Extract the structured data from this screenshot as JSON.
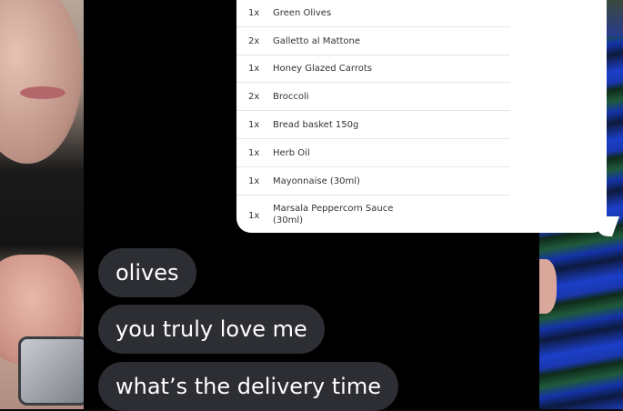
{
  "order_items": [
    {
      "qty": "1x",
      "name": "Green Olives"
    },
    {
      "qty": "2x",
      "name": "Galletto al Mattone"
    },
    {
      "qty": "1x",
      "name": "Honey Glazed Carrots"
    },
    {
      "qty": "2x",
      "name": "Broccoli"
    },
    {
      "qty": "1x",
      "name": "Bread basket 150g"
    },
    {
      "qty": "1x",
      "name": "Herb Oil"
    },
    {
      "qty": "1x",
      "name": "Mayonnaise (30ml)"
    },
    {
      "qty": "1x",
      "name": "Marsala Peppercorn Sauce (30ml)"
    }
  ],
  "messages": [
    {
      "text": "olives"
    },
    {
      "text": "you truly love me"
    },
    {
      "text": "what’s the delivery time"
    }
  ],
  "colors": {
    "bubble_bg": "#2c2e34",
    "chat_bg": "#000000",
    "order_card_bg": "#ffffff"
  }
}
